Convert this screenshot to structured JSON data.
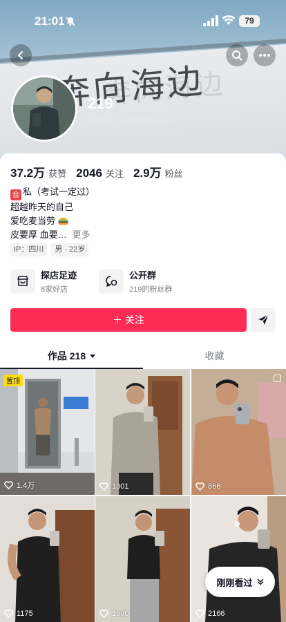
{
  "status_bar": {
    "time": "21:01",
    "battery": "79"
  },
  "profile": {
    "nickname": "219",
    "douyin_id": "抖音号：136328942",
    "banner_text": "奔向海边",
    "stats": [
      {
        "value": "37.2万",
        "label": "获赞"
      },
      {
        "value": "2046",
        "label": "关注"
      },
      {
        "value": "2.9万",
        "label": "粉丝"
      }
    ],
    "bio": {
      "tag": "合",
      "line1": "私（考试一定过）",
      "line2": "超越昨天的自己",
      "line3": "爱吃麦当劳",
      "line4": "皮要厚 血要…",
      "more": "更多"
    },
    "chips": [
      "IP：四川",
      "男 · 22岁"
    ]
  },
  "services": [
    {
      "title": "探店足迹",
      "subtitle": "8家好店",
      "icon": "shop-icon"
    },
    {
      "title": "公开群",
      "subtitle": "219的粉丝群",
      "icon": "chat-group-icon"
    }
  ],
  "actions": {
    "follow_label": "＋ 关注",
    "share_icon": "send-icon"
  },
  "tabs": {
    "works": "作品 218",
    "favorites": "收藏"
  },
  "grid": [
    {
      "likes": "1.4万",
      "pinned": "置顶"
    },
    {
      "likes": "1301"
    },
    {
      "likes": "866"
    },
    {
      "likes": "1175"
    },
    {
      "likes": "1300"
    },
    {
      "likes": "2166"
    }
  ],
  "floating": {
    "recently_viewed": "刚刚看过"
  },
  "colors": {
    "follow": "#fe2c55",
    "pin": "#fadb14"
  }
}
